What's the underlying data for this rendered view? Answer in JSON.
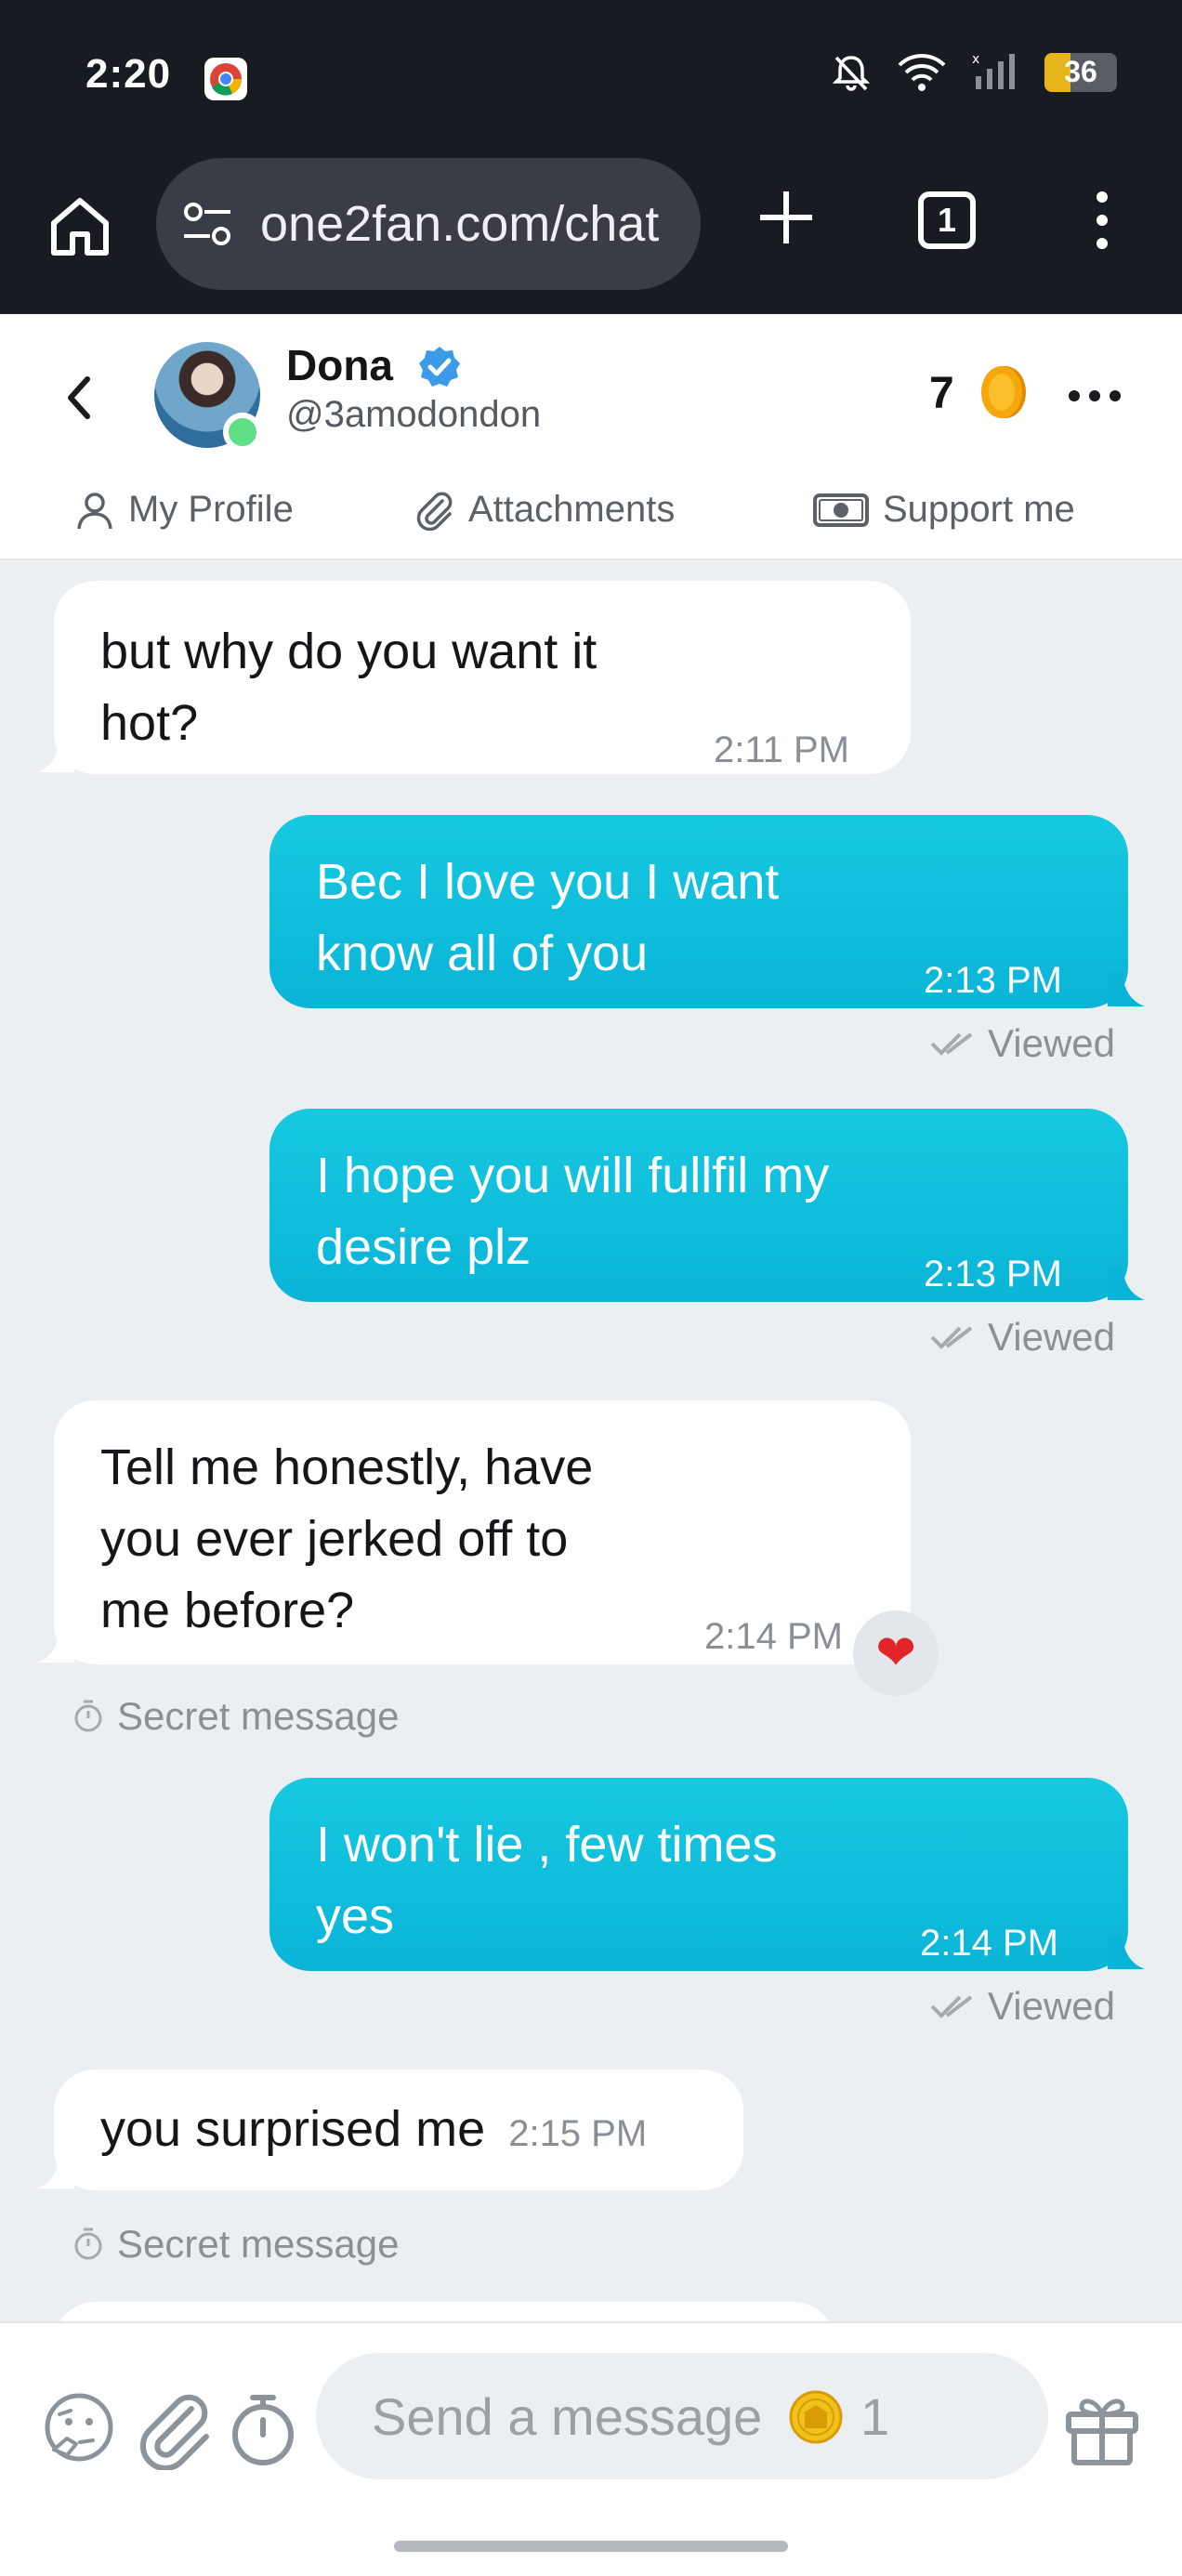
{
  "status_bar": {
    "time": "2:20",
    "battery": 36,
    "icons": [
      "chrome-icon",
      "mute-icon",
      "wifi-icon",
      "signal-icon",
      "battery-icon"
    ]
  },
  "browser": {
    "url": "one2fan.com/chat",
    "tab_count": "1"
  },
  "header": {
    "name": "Dona",
    "handle": "@3amodondon",
    "coin_count": "7",
    "online": true,
    "tabs": [
      {
        "label": "My Profile",
        "icon": "user-icon"
      },
      {
        "label": "Attachments",
        "icon": "paperclip-icon"
      },
      {
        "label": "Support me",
        "icon": "cash-icon"
      }
    ]
  },
  "messages": [
    {
      "dir": "in",
      "text_lines": [
        "but why do you want it",
        "hot?"
      ],
      "time": "2:11 PM"
    },
    {
      "dir": "out",
      "text_lines": [
        "Bec I love you I want",
        "know all of you"
      ],
      "time": "2:13 PM",
      "status": "Viewed"
    },
    {
      "dir": "out",
      "text_lines": [
        "I hope you will fullfil my",
        "desire plz"
      ],
      "time": "2:13 PM",
      "status": "Viewed"
    },
    {
      "dir": "in",
      "text_lines": [
        "Tell me honestly, have",
        "you ever jerked off to",
        "me before?"
      ],
      "time": "2:14 PM",
      "reaction": "❤",
      "note": "Secret message"
    },
    {
      "dir": "out",
      "text_lines": [
        "I won't lie , few times",
        "yes"
      ],
      "time": "2:14 PM",
      "status": "Viewed"
    },
    {
      "dir": "in",
      "text_lines": [
        "you surprised me"
      ],
      "time": "2:15 PM",
      "note": "Secret message"
    }
  ],
  "composer": {
    "placeholder": "Send a message",
    "cost": "1",
    "icons": [
      "emoji-think-icon",
      "paperclip-icon",
      "timer-icon",
      "gift-icon"
    ]
  },
  "colors": {
    "outgoing_bubble": "#12c0dc",
    "incoming_bubble": "#ffffff",
    "chat_bg": "#eceff2",
    "status_bg": "#181b22",
    "verified": "#3b9be8",
    "coin": "#f6a70d"
  }
}
